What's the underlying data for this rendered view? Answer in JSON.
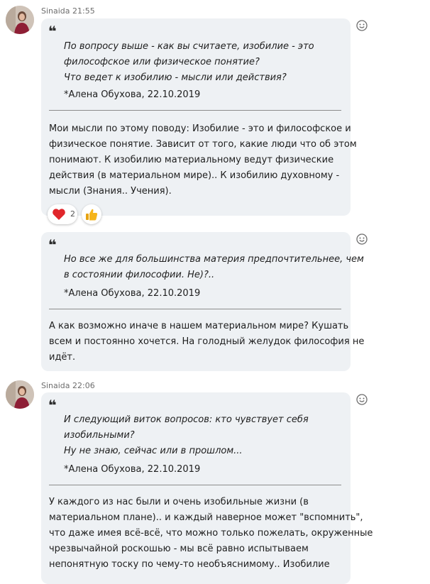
{
  "messages": [
    {
      "author": "Sinaida",
      "time": "21:55",
      "quote_mark": "❝",
      "quote_lines": [
        "По вопросу выше - как вы считаете, изобилие - это",
        "философское или физическое понятие?",
        "Что ведет к изобилию - мысли или действия?"
      ],
      "quote_source": "*Алена Обухова, 22.10.2019",
      "body_lines": [
        "Мои мысли по этому поводу: Изобилие - это и философское и",
        "физическое понятие. Зависит от того, какие люди что об этом",
        "понимают. К изобилию материальному ведут физические",
        "действия (в материальном мире).. К изобилию духовному -",
        "мысли (Знания.. Учения)."
      ],
      "reactions": [
        {
          "icon": "heart-icon",
          "count": "2"
        },
        {
          "icon": "thumbs-up-icon",
          "count": ""
        }
      ]
    },
    {
      "quote_mark": "❝",
      "quote_lines": [
        "Но все же для большинства материя предпочтительнее, чем",
        "в состоянии философии. Не)?.."
      ],
      "quote_source": "*Алена Обухова, 22.10.2019",
      "body_lines": [
        "А как возможно иначе в нашем материальном мире? Кушать",
        "всем и постоянно хочется. На голодный желудок философия не",
        "идёт."
      ]
    },
    {
      "author": "Sinaida",
      "time": "22:06",
      "quote_mark": "❝",
      "quote_lines": [
        "И следующий виток вопросов: кто чувствует себя",
        "изобильными?",
        "Ну не знаю, сейчас или в прошлом..."
      ],
      "quote_source": "*Алена Обухова, 22.10.2019",
      "body_lines": [
        "У каждого из нас были и очень изобильные жизни (в",
        "материальном плане).. и каждый наверное может \"вспомнить\",",
        "что даже имея всё-всё, что можно только пожелать, окруженные",
        "чрезвычайной роскошью - мы всё равно испытываем",
        "непонятную тоску по чему-то необъяснимому..    Изобилие"
      ]
    }
  ],
  "icons": {
    "add_reaction": "smiley-icon",
    "heart_color": "#e0262b",
    "thumb_color": "#f5b41a"
  }
}
